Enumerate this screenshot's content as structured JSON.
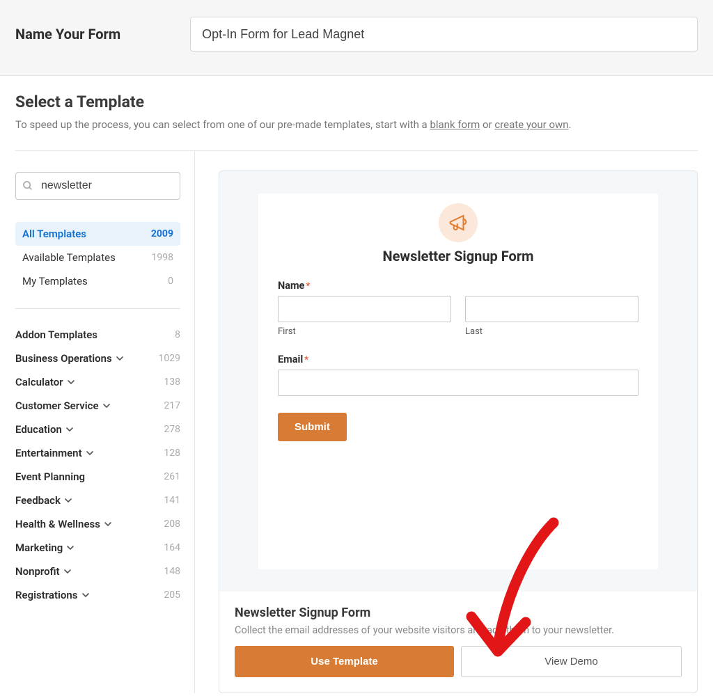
{
  "header": {
    "label": "Name Your Form",
    "input_value": "Opt-In Form for Lead Magnet"
  },
  "section": {
    "title": "Select a Template",
    "subtext_pre": "To speed up the process, you can select from one of our pre-made templates, start with a ",
    "link_blank": "blank form",
    "subtext_mid": " or ",
    "link_create": "create your own",
    "subtext_end": "."
  },
  "search": {
    "value": "newsletter",
    "placeholder": "Search"
  },
  "filters": [
    {
      "label": "All Templates",
      "count": "2009",
      "active": true
    },
    {
      "label": "Available Templates",
      "count": "1998",
      "active": false
    },
    {
      "label": "My Templates",
      "count": "0",
      "active": false
    }
  ],
  "categories": [
    {
      "label": "Addon Templates",
      "count": "8",
      "expandable": false
    },
    {
      "label": "Business Operations",
      "count": "1029",
      "expandable": true
    },
    {
      "label": "Calculator",
      "count": "138",
      "expandable": true
    },
    {
      "label": "Customer Service",
      "count": "217",
      "expandable": true
    },
    {
      "label": "Education",
      "count": "278",
      "expandable": true
    },
    {
      "label": "Entertainment",
      "count": "128",
      "expandable": true
    },
    {
      "label": "Event Planning",
      "count": "261",
      "expandable": false
    },
    {
      "label": "Feedback",
      "count": "141",
      "expandable": true
    },
    {
      "label": "Health & Wellness",
      "count": "208",
      "expandable": true
    },
    {
      "label": "Marketing",
      "count": "164",
      "expandable": true
    },
    {
      "label": "Nonprofit",
      "count": "148",
      "expandable": true
    },
    {
      "label": "Registrations",
      "count": "205",
      "expandable": true
    }
  ],
  "preview": {
    "form_title": "Newsletter Signup Form",
    "name_label": "Name",
    "first_label": "First",
    "last_label": "Last",
    "email_label": "Email",
    "submit": "Submit",
    "footer_title": "Newsletter Signup Form",
    "footer_desc": "Collect the email addresses of your website visitors and add them to your newsletter.",
    "use_template": "Use Template",
    "view_demo": "View Demo"
  }
}
